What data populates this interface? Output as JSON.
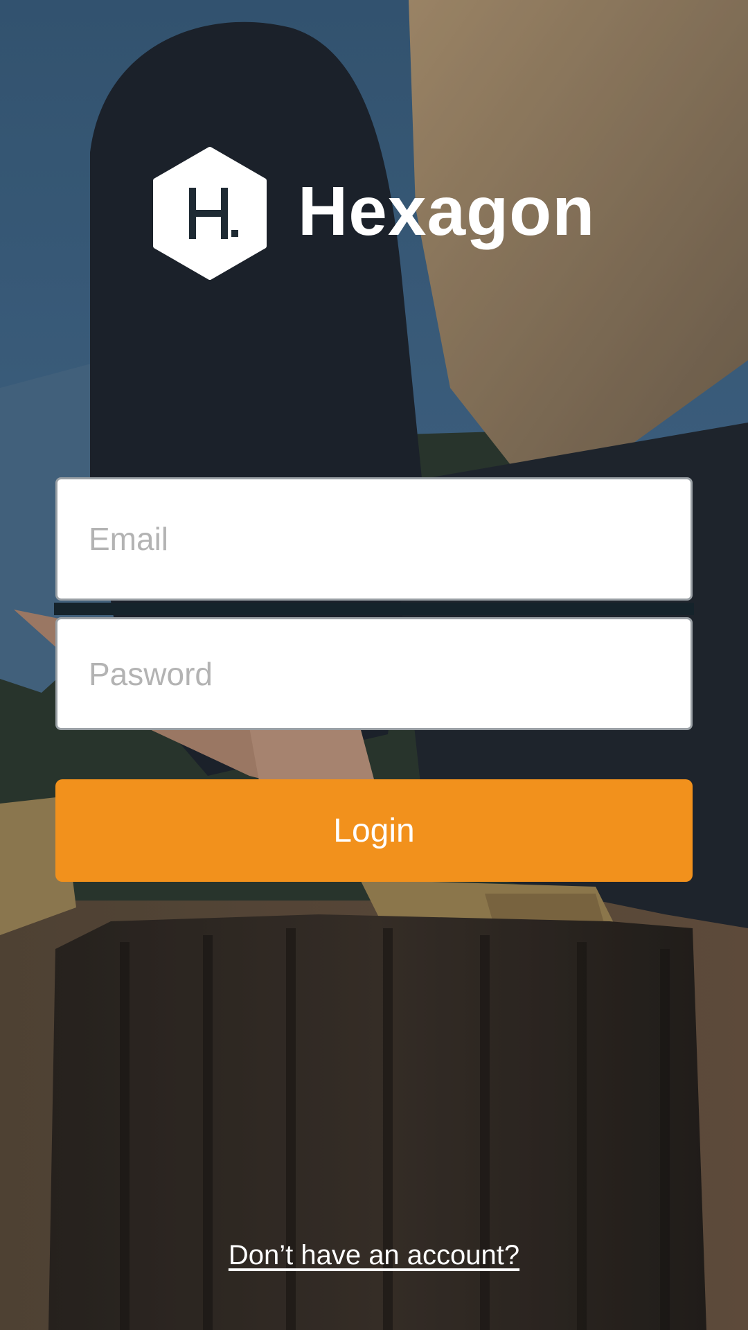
{
  "brand": {
    "name": "Hexagon",
    "mark_letter": "H."
  },
  "form": {
    "email_placeholder": "Email",
    "email_value": "",
    "password_placeholder": "Pasword",
    "password_value": "",
    "login_label": "Login"
  },
  "footer": {
    "signup_link": "Don’t have an account?"
  },
  "colors": {
    "accent": "#f2911c",
    "logo": "#ffffff",
    "field_bg": "#ffffff",
    "placeholder": "#b3b3b3"
  },
  "icons": {
    "logo_mark": "hexagon-logo-icon"
  }
}
